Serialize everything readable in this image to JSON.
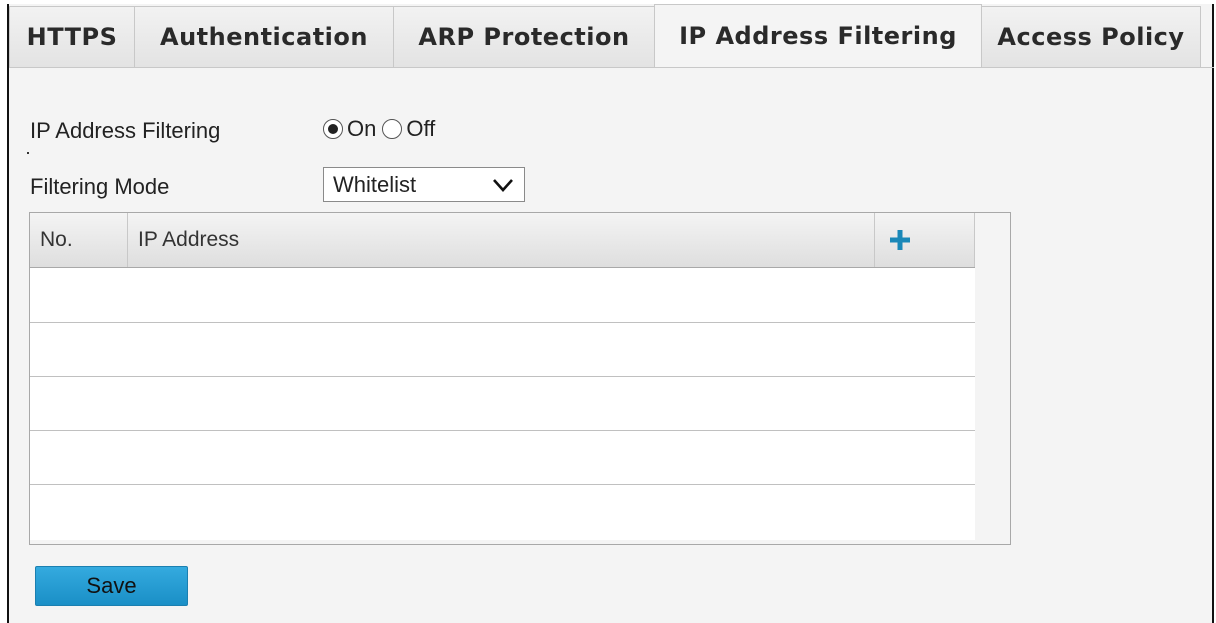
{
  "tabs": [
    {
      "label": "HTTPS",
      "active": false
    },
    {
      "label": "Authentication",
      "active": false
    },
    {
      "label": "ARP Protection",
      "active": false
    },
    {
      "label": "IP Address Filtering",
      "active": true
    },
    {
      "label": "Access Policy",
      "active": false
    }
  ],
  "form": {
    "filtering_label": "IP Address Filtering",
    "on_label": "On",
    "off_label": "Off",
    "filtering_value": "On",
    "mode_label": "Filtering Mode",
    "mode_value": "Whitelist"
  },
  "table": {
    "columns": [
      "No.",
      "IP Address"
    ],
    "add_icon": "plus-icon",
    "rows": []
  },
  "actions": {
    "save_label": "Save"
  },
  "colors": {
    "accent": "#1a8fc6",
    "add_icon": "#1a88b8"
  }
}
